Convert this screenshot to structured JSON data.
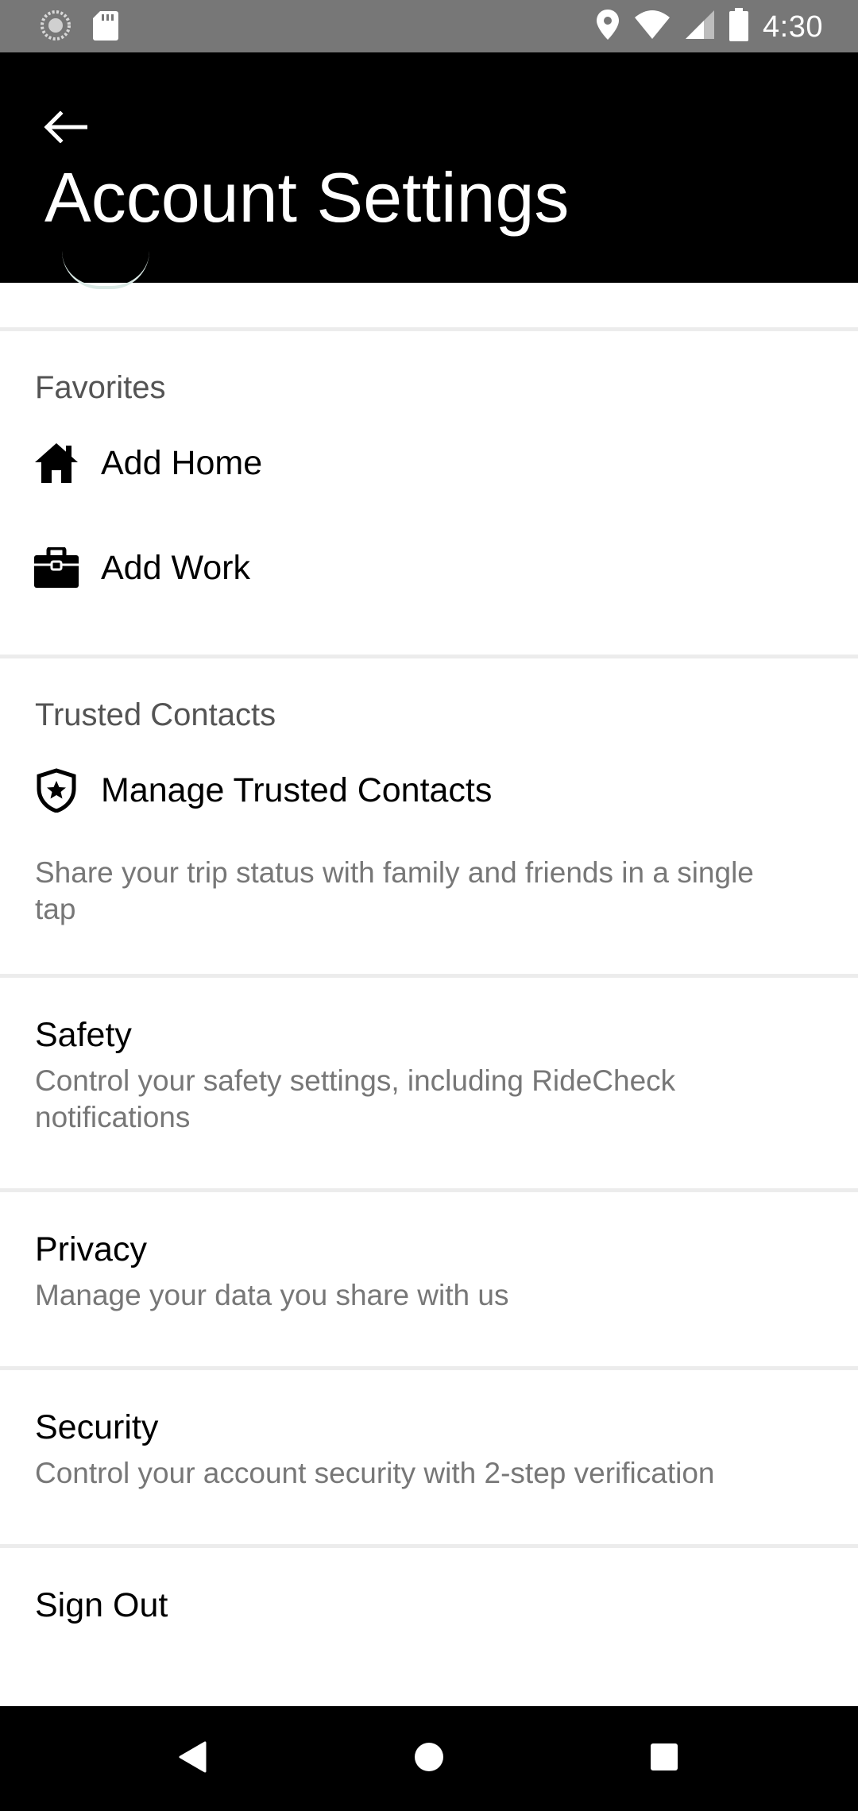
{
  "status_bar": {
    "time": "4:30",
    "icons": [
      "sync-icon",
      "sd-card-icon",
      "location-icon",
      "wifi-icon",
      "signal-icon",
      "battery-icon"
    ]
  },
  "header": {
    "title": "Account Settings",
    "back_icon": "arrow-left-icon"
  },
  "favorites": {
    "heading": "Favorites",
    "items": [
      {
        "label": "Add Home",
        "icon": "home-icon"
      },
      {
        "label": "Add Work",
        "icon": "briefcase-icon"
      }
    ]
  },
  "trusted_contacts": {
    "heading": "Trusted Contacts",
    "item": {
      "label": "Manage Trusted Contacts",
      "icon": "shield-star-icon"
    },
    "description": "Share your trip status with family and friends in a single tap"
  },
  "safety": {
    "title": "Safety",
    "description": "Control your safety settings, including RideCheck notifications"
  },
  "privacy": {
    "title": "Privacy",
    "description": "Manage your data you share with us"
  },
  "security": {
    "title": "Security",
    "description": "Control your account security with 2-step verification"
  },
  "sign_out": {
    "label": "Sign Out"
  },
  "nav": {
    "icons": [
      "back-triangle-icon",
      "home-circle-icon",
      "recents-square-icon"
    ]
  }
}
